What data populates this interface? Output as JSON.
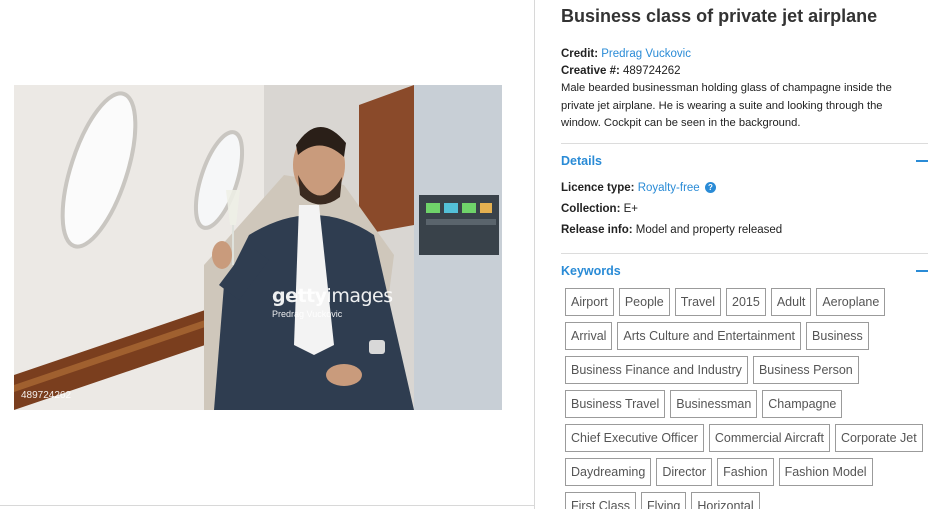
{
  "photo": {
    "watermark_brand": "gettyimages",
    "watermark_brand_bold": "getty",
    "watermark_brand_thin": "images",
    "watermark_credit": "Predrag Vuckovic",
    "image_id": "489724262"
  },
  "details_panel": {
    "title": "Business class of private jet airplane",
    "credit_label": "Credit:",
    "credit_value": "Predrag Vuckovic",
    "creative_label": "Creative #:",
    "creative_value": "489724262",
    "description": "Male bearded businessman holding glass of champagne inside the private jet airplane. He is wearing a suite and looking through the window. Cockpit can be seen in the background."
  },
  "details_section": {
    "title": "Details",
    "licence_label": "Licence type:",
    "licence_value": "Royalty-free",
    "help_symbol": "?",
    "collection_label": "Collection:",
    "collection_value": "E+",
    "release_label": "Release info:",
    "release_value": "Model and property released"
  },
  "keywords_section": {
    "title": "Keywords",
    "items": [
      "Airport",
      "People",
      "Travel",
      "2015",
      "Adult",
      "Aeroplane",
      "Arrival",
      "Arts Culture and Entertainment",
      "Business",
      "Business Finance and Industry",
      "Business Person",
      "Business Travel",
      "Businessman",
      "Champagne",
      "Chief Executive Officer",
      "Commercial Aircraft",
      "Corporate Jet",
      "Daydreaming",
      "Director",
      "Fashion",
      "Fashion Model",
      "First Class",
      "Flying",
      "Horizontal"
    ]
  },
  "colors": {
    "link": "#2a8bd6",
    "keyword_border": "#9b9b9b",
    "divider": "#d8d8d8"
  }
}
